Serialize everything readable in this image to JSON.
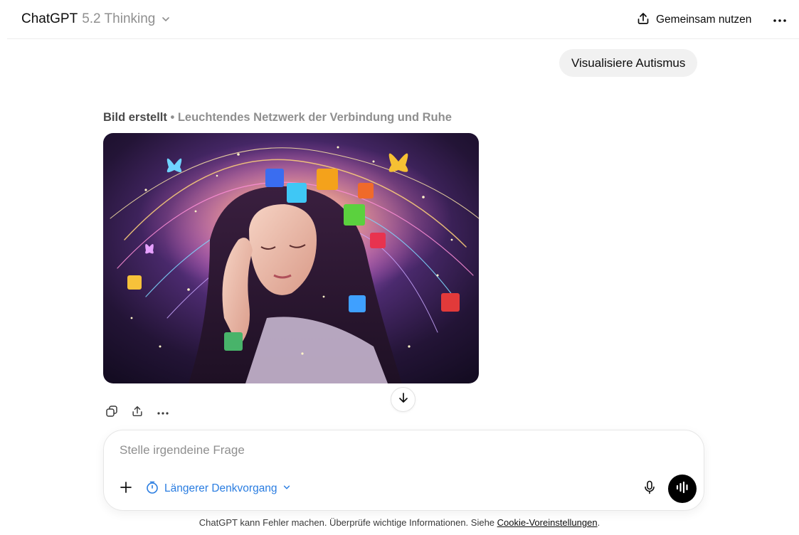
{
  "header": {
    "model_name": "ChatGPT",
    "model_version": "5.2 Thinking",
    "share_label": "Gemeinsam nutzen",
    "icons": {
      "model_menu": "chevron-down-icon",
      "share": "share-icon",
      "more": "more-horizontal-icon"
    }
  },
  "conversation": {
    "user_message": "Visualisiere Autismus",
    "assistant": {
      "image_caption_prefix": "Bild erstellt",
      "image_caption_separator": "•",
      "image_title": "Leuchtendes Netzwerk der Verbindung und Ruhe",
      "image_icon": "generated-image-woman-neural-network-puzzle-pieces",
      "actions": [
        "copy-icon",
        "share-icon",
        "more-horizontal-icon"
      ]
    },
    "scroll_down_icon": "arrow-down-icon"
  },
  "composer": {
    "placeholder": "Stelle irgendeine Frage",
    "value": "",
    "reasoning_label": "Längerer Denkvorgang",
    "icons": {
      "add": "plus-icon",
      "reasoning": "timer-icon",
      "reasoning_menu": "chevron-down-icon",
      "mic": "microphone-icon",
      "voice": "voice-waveform-icon"
    }
  },
  "footer": {
    "note": "ChatGPT kann Fehler machen. Überprüfe wichtige Informationen. Siehe",
    "link": "Cookie-Voreinstellungen",
    "end": "."
  },
  "colors": {
    "accent_blue": "#2a7de1",
    "user_bubble_bg": "#f1f1f1",
    "voice_button_bg": "#000000",
    "muted_text": "#8f8f8f"
  }
}
